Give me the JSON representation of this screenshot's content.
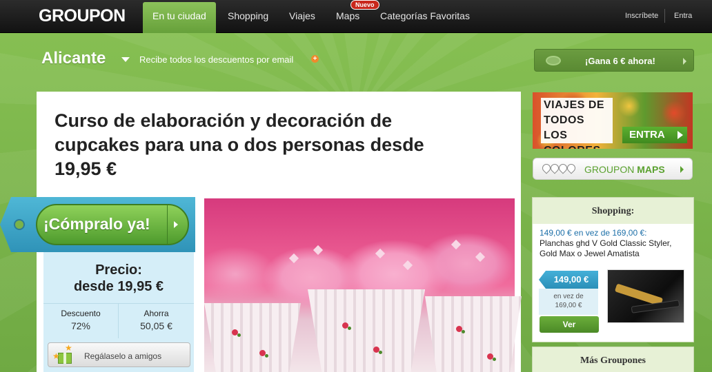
{
  "nav": {
    "logo": "GROUPON",
    "items": [
      {
        "label": "En tu ciudad",
        "active": true
      },
      {
        "label": "Shopping"
      },
      {
        "label": "Viajes"
      },
      {
        "label": "Maps"
      },
      {
        "label": "Categorías Favoritas"
      }
    ],
    "badge": "Nuevo",
    "signup": "Inscríbete",
    "login": "Entra"
  },
  "city_bar": {
    "city": "Alicante",
    "email_text": "Recibe todos los descuentos por email",
    "earn_button": "¡Gana 6 € ahora!"
  },
  "deal": {
    "title": "Curso de elaboración y decoración de cupcakes para una o dos personas desde 19,95 €",
    "buy_label": "¡Cómpralo ya!",
    "price_label": "Precio:",
    "price_value": "desde 19,95 €",
    "discount_label": "Descuento",
    "discount_value": "72%",
    "saving_label": "Ahorra",
    "saving_value": "50,05 €",
    "gift_label": "Regálaselo a amigos"
  },
  "sidebar": {
    "viajes_lines": [
      "VIAJES DE",
      "TODOS LOS",
      "COLORES"
    ],
    "entra_label": "ENTRA",
    "maps_prefix": "GROUPON",
    "maps_bold": "MAPS",
    "shopping": {
      "title": "Shopping:",
      "price_line": "149,00 € en vez de 169,00 €:",
      "description": "Planchas ghd V Gold Classic Styler, Gold Max o Jewel Amatista",
      "tag_price": "149,00 €",
      "old_price_line1": "en vez de",
      "old_price_line2": "169,00 €",
      "view_button": "Ver"
    },
    "more_title": "Más Groupones"
  },
  "colors": {
    "accent_green": "#7ab34a",
    "tag_blue": "#2f93b8",
    "link_blue": "#1c6fa8",
    "badge_red": "#c8271b"
  }
}
